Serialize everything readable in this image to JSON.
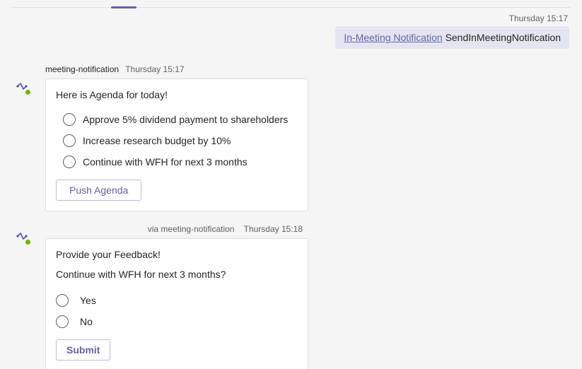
{
  "header": {
    "timestamp": "Thursday 15:17"
  },
  "outgoing": {
    "link_text": "In-Meeting Notification",
    "command": "SendInMeetingNotification"
  },
  "messages": [
    {
      "sender": "meeting-notification",
      "time": "Thursday 15:17",
      "card": {
        "title": "Here is Agenda for today!",
        "options": [
          "Approve 5% dividend payment to shareholders",
          "Increase research budget by 10%",
          "Continue with WFH for next 3 months"
        ],
        "button": "Push Agenda"
      }
    },
    {
      "via": "via meeting-notification",
      "time": "Thursday 15:18",
      "card": {
        "title": "Provide your Feedback!",
        "subtitle": "Continue with WFH for next 3 months?",
        "options": [
          "Yes",
          "No"
        ],
        "button": "Submit"
      }
    }
  ],
  "icons": {
    "app": "app-icon"
  }
}
